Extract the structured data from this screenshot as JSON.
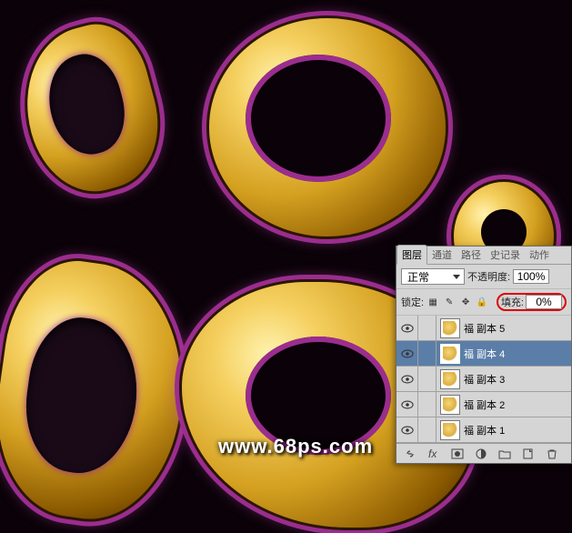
{
  "watermark": "www.68ps.com",
  "panel": {
    "tabs": {
      "layers": "图层",
      "channels": "通道",
      "paths": "路径",
      "history": "史记录",
      "actions": "动作"
    },
    "blend": {
      "mode": "正常",
      "opacity_label": "不透明度:",
      "opacity_value": "100%"
    },
    "lock": {
      "label": "锁定:",
      "fill_label": "填充:",
      "fill_value": "0%"
    },
    "layers": [
      {
        "name": "福 副本 5",
        "selected": false
      },
      {
        "name": "福 副本 4",
        "selected": true
      },
      {
        "name": "福 副本 3",
        "selected": false
      },
      {
        "name": "福 副本 2",
        "selected": false
      },
      {
        "name": "福 副本 1",
        "selected": false
      }
    ]
  }
}
